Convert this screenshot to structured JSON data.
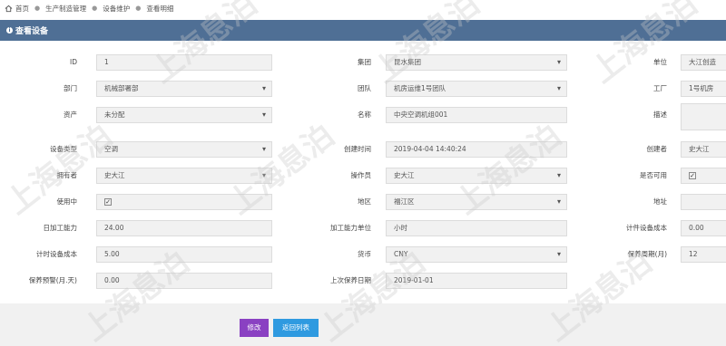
{
  "breadcrumb": [
    "首页",
    "生产制造管理",
    "设备维护",
    "查看明细"
  ],
  "panel": {
    "title": "查看设备"
  },
  "form": {
    "id": {
      "label": "ID",
      "value": "1"
    },
    "group": {
      "label": "集团",
      "value": "昆水集团"
    },
    "unit": {
      "label": "单位",
      "value": "大江创造"
    },
    "department": {
      "label": "部门",
      "value": "机械部署部"
    },
    "team": {
      "label": "团队",
      "value": "机房运维1号团队"
    },
    "factory": {
      "label": "工厂",
      "value": "1号机房"
    },
    "asset": {
      "label": "资产",
      "value": "未分配"
    },
    "name": {
      "label": "名称",
      "value": "中央空调机组001"
    },
    "description": {
      "label": "描述",
      "value": ""
    },
    "equipment_type": {
      "label": "设备类型",
      "value": "空调"
    },
    "created_time": {
      "label": "创建时间",
      "value": "2019-04-04 14:40:24"
    },
    "creator": {
      "label": "创建者",
      "value": "史大江"
    },
    "owner": {
      "label": "拥有者",
      "value": "史大江"
    },
    "operator": {
      "label": "操作员",
      "value": "史大江"
    },
    "available": {
      "label": "是否可用",
      "checked": true
    },
    "in_use": {
      "label": "使用中",
      "checked": true
    },
    "region": {
      "label": "地区",
      "value": "福江区"
    },
    "address": {
      "label": "地址",
      "value": ""
    },
    "daily_capacity": {
      "label": "日加工能力",
      "value": "24.00"
    },
    "capacity_unit": {
      "label": "加工能力单位",
      "value": "小时"
    },
    "piece_cost": {
      "label": "计件设备成本",
      "value": "0.00"
    },
    "time_cost": {
      "label": "计时设备成本",
      "value": "5.00"
    },
    "currency": {
      "label": "货币",
      "value": "CNY"
    },
    "maintenance_cycle": {
      "label": "保养周期(月)",
      "value": "12"
    },
    "maintenance_warning": {
      "label": "保养预警(月.天)",
      "value": "0.00"
    },
    "last_maintenance": {
      "label": "上次保养日期",
      "value": "2019-01-01"
    }
  },
  "actions": {
    "edit": "修改",
    "back": "返回列表"
  },
  "watermark": "上海息泊"
}
